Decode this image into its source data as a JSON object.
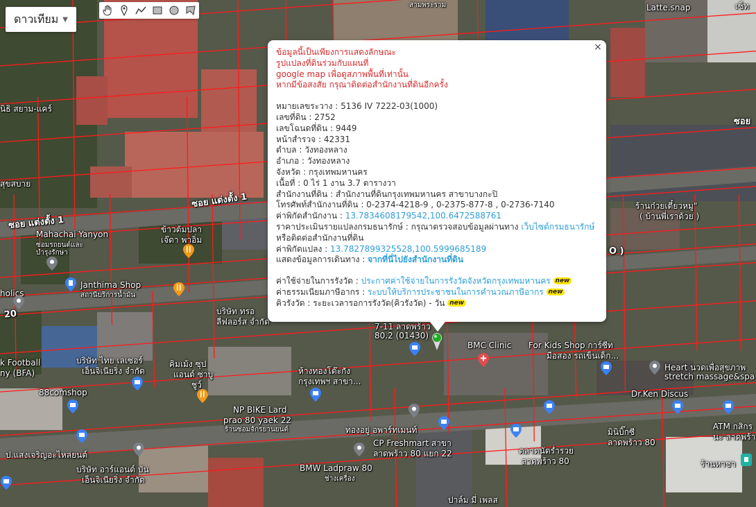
{
  "map_type_control": {
    "label": "ดาวเทียม"
  },
  "drawing_tools": [
    "hand-icon",
    "marker-icon",
    "polyline-icon",
    "rectangle-icon",
    "circle-icon",
    "polygon-icon"
  ],
  "colors": {
    "parcel_lines": "#ff1a1a",
    "disclaimer": "#d42a2a",
    "link": "#2e9ed8",
    "badge": "#ffe600",
    "pin_selected": "#22aa22"
  },
  "map_labels": {
    "road_soi_1": "ซอย แต่งตั้ง 1",
    "road_soi_1b": "ซอย แต่งตั้ง 1",
    "road_20": "20",
    "road_o": "O )",
    "siam_care": "นิธิ สยาม-แคร์",
    "sukhsabai": "สุขสบาย",
    "mahachai": "Mahachai Yanyon",
    "mahachai_sub": "ซ่อมรถยนต์และ",
    "mahachai_sub2": "บำรุงรักษา",
    "khaotom": "ข้าวต้มปลา",
    "khaotom2": "เจ๊ดา พาอิ่ม",
    "janthima": "Janthima Shop",
    "janthima_sub": "สถานีบริการน้ำมัน",
    "catholics": "holics",
    "company_tro": "บริษัท ทรอ",
    "company_tro2": "ลี่ฟลอร์ส จำกัด",
    "seven": "7-11 ลาดพร้าว",
    "seven2": "80.2 (01430)",
    "bmc": "BMC Clinic",
    "forkids": "For Kids Shop การ์ซีท",
    "forkids2": "มือสอง รถเข็นเด็ก...",
    "heart": "Heart นวดเพื่อสุขภาพ",
    "heart2": "stretch massage&spa",
    "football": "k Football",
    "football2": "ny (BFA)",
    "thailaser": "บริษัท ไทย เลเซอร์",
    "thailaser2": "เอ็นจิเนียริ่ง จำกัด",
    "kim": "คิมเม้ง ซุป",
    "kim2": "แอนด์ ซาบู",
    "kim3": "ชูว์",
    "hangthong": "ห้างทองโต๊ะกัง",
    "hangthong2": "กรุงเทพฯ สาขา...",
    "comshop": "88comshop",
    "npbike": "NP BIKE Lard",
    "npbike2": "prao 80 yaek 22",
    "npbike3": "ร้านซ่อมจักรยานยนต์",
    "thongyu": "ทองอยู่ อพาร์ทเมนท์",
    "cpfresh": "CP Freshmart สาขา",
    "cpfresh2": "ลาดพร้าว 80 แยก 22",
    "drken": "Dr.Ken Discus",
    "minibigc": "มินิบิ๊กซี",
    "minibigc2": "ลาดพร้าว 80",
    "talad": "ตลาดนัดร่ำรวย",
    "talad2": "ลาดพร้าว 80",
    "atm": "ATM กสิกร",
    "atm2": "นะ ลาดพร้าว",
    "raan": "ร้านหาชา",
    "sangcharoen": "ป.แสงเจริญอะไหล่ยนต์",
    "agend": "บริษัท อาร์แอนด์ บัน",
    "agend2": "เอ็นจิเนียริ่ง จำกัด",
    "bmw": "BMW Ladpraw 80",
    "bmw2": "ช่างเครื่อง",
    "palm": "ปาล์ม มี่ เพลส",
    "latte": "Latte.snap",
    "kuay": "ร้านก๋วยเตี๋ยวหมู\"",
    "kuay2": "( บ้านพี่เราด้วย )",
    "sayam_top": "สามพระราม",
    "sob": "ซอย",
    "set": "เซ็ท"
  },
  "info_window": {
    "close": "×",
    "disclaimer": [
      "ข้อมูลนี้เป็นเพียงการแสดงลักษณะ",
      "รูปแปลงที่ดินร่วมกับแผนที่",
      "google map เพื่อดูสภาพพื้นที่เท่านั้น",
      "หากมีข้อสงสัย กรุณาติดต่อสำนักงานที่ดินอีกครั้ง"
    ],
    "fields": {
      "map_sheet_label": "หมายเลขระวาง",
      "map_sheet": "5136 IV 7222-03(1000)",
      "land_no_label": "เลขที่ดิน",
      "land_no": "2752",
      "deed_no_label": "เลขโฉนดที่ดิน",
      "deed_no": "9449",
      "survey_page_label": "หน้าสำรวจ",
      "survey_page": "42331",
      "subdistrict_label": "ตำบล",
      "subdistrict": "วังทองหลาง",
      "district_label": "อำเภอ",
      "district": "วังทองหลาง",
      "province_label": "จังหวัด",
      "province": "กรุงเทพมหานคร",
      "area_label": "เนื้อที่",
      "area": "0 ไร่ 1 งาน 3.7 ตารางวา",
      "office_label": "สำนักงานที่ดิน",
      "office": "สำนักงานที่ดินกรุงเทพมหานคร สาขาบางกะปิ",
      "phone_label": "โทรศัพท์สำนักงานที่ดิน",
      "phone": "0-2374-4218-9 , 0-2375-877-8 , 0-2736-7140",
      "office_coord_label": "ค่าพิกัดสำนักงาน",
      "office_coord": "13.7834608179542,100.6472588761",
      "appraisal_label": "ราคาประเมินรายแปลงกรมธนารักษ์",
      "appraisal_text": "กรุณาตรวจสอบข้อมูลผ่านทาง",
      "appraisal_link": "เว็บไซต์กรมธนารักษ์",
      "appraisal_text2": "หรือติดต่อสำนักงานที่ดิน",
      "parcel_coord_label": "ค่าพิกัดแปลง",
      "parcel_coord": "13.7827899325528,100.5999685189",
      "directions_label": "แสดงข้อมูลการเดินทาง",
      "directions_link": "จากที่นี่ไปยังสำนักงานที่ดิน",
      "fee_label": "ค่าใช้จ่ายในการรังวัด",
      "fee_link": "ประกาศค่าใช้จ่ายในการรังวัดจังหวัดกรุงเทพมหานคร",
      "tax_label": "ค่าธรรมเนียมภาษีอากร",
      "tax_link": "ระบบให้บริการประชาชนในการคำนวณภาษีอากร",
      "queue_label": "คิวรังวัด",
      "queue_text": "ระยะเวลารอการรังวัด(คิวรังวัด) - วัน",
      "new_badge": "new"
    }
  }
}
